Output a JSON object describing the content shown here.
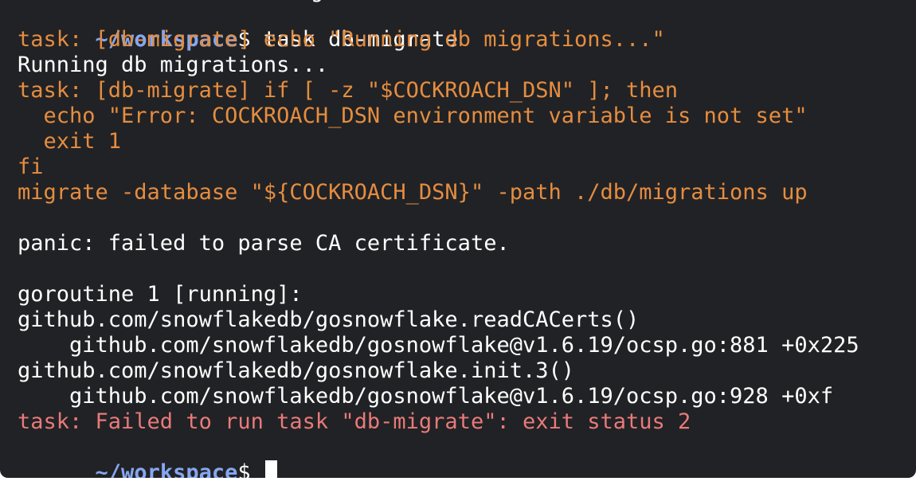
{
  "terminal": {
    "clipped_top_text": "g",
    "prompt": {
      "path": "~/workspace",
      "sign": "$"
    },
    "command": " task db-migrate",
    "lines": [
      {
        "text": "task: [db-migrate] echo \"Running db migrations...\"",
        "color": "#e58d40"
      },
      {
        "text": "Running db migrations...",
        "color": "#ffffff"
      },
      {
        "text": "task: [db-migrate] if [ -z \"$COCKROACH_DSN\" ]; then",
        "color": "#e58d40"
      },
      {
        "text": "  echo \"Error: COCKROACH_DSN environment variable is not set\"",
        "color": "#e58d40"
      },
      {
        "text": "  exit 1",
        "color": "#e58d40"
      },
      {
        "text": "fi",
        "color": "#e58d40"
      },
      {
        "text": "migrate -database \"${COCKROACH_DSN}\" -path ./db/migrations up",
        "color": "#e58d40"
      },
      {
        "text": "",
        "color": "#ffffff"
      },
      {
        "text": "panic: failed to parse CA certificate.",
        "color": "#ffffff"
      },
      {
        "text": "",
        "color": "#ffffff"
      },
      {
        "text": "goroutine 1 [running]:",
        "color": "#ffffff"
      },
      {
        "text": "github.com/snowflakedb/gosnowflake.readCACerts()",
        "color": "#ffffff"
      },
      {
        "text": "    github.com/snowflakedb/gosnowflake@v1.6.19/ocsp.go:881 +0x225",
        "color": "#ffffff"
      },
      {
        "text": "github.com/snowflakedb/gosnowflake.init.3()",
        "color": "#ffffff"
      },
      {
        "text": "    github.com/snowflakedb/gosnowflake@v1.6.19/ocsp.go:928 +0xf",
        "color": "#ffffff"
      },
      {
        "text": "task: Failed to run task \"db-migrate\": exit status 2",
        "color": "#e97a7a"
      }
    ],
    "colors": {
      "background": "#212225",
      "prompt_path": "#86a6f0",
      "task_echo": "#e58d40",
      "error": "#e97a7a",
      "default_text": "#ffffff"
    }
  }
}
